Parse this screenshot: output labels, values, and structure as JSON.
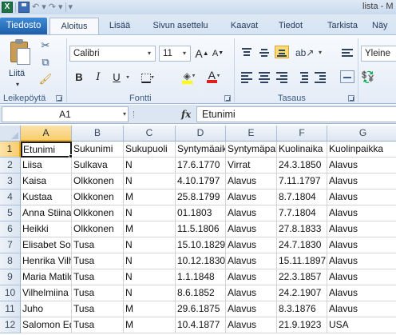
{
  "app": {
    "logo_letter": "X",
    "window_title": "lista - M",
    "quick_access": [
      "save-icon",
      "undo-icon",
      "redo-icon"
    ],
    "undo_glyph": "↶",
    "redo_glyph": "↷",
    "dropdown_glyph": "▾",
    "accent_color": "#1f5ea8"
  },
  "tabs": [
    "Tiedosto",
    "Aloitus",
    "Lisää",
    "Sivun asettelu",
    "Kaavat",
    "Tiedot",
    "Tarkista",
    "Näy"
  ],
  "active_tab": "Aloitus",
  "ribbon": {
    "clipboard": {
      "label": "Leikepöytä",
      "paste_label": "Liitä"
    },
    "font": {
      "label": "Fontti",
      "font_name": "Calibri",
      "font_size": "11",
      "bold": "B",
      "italic": "I",
      "underline": "U",
      "grow": "A",
      "shrink": "A"
    },
    "alignment": {
      "label": "Tasaus"
    },
    "number": {
      "format": "Yleine"
    }
  },
  "formula_bar": {
    "name_box": "A1",
    "fx": "fx",
    "formula": "Etunimi"
  },
  "sheet": {
    "columns": [
      "A",
      "B",
      "C",
      "D",
      "E",
      "F",
      "G"
    ],
    "selected_cell": "A1",
    "rows": [
      {
        "num": "1",
        "cells": [
          "Etunimi",
          "Sukunimi",
          "Sukupuoli",
          "Syntymäaika",
          "Syntymäpaikka",
          "Kuolinaika",
          "Kuolinpaikka"
        ]
      },
      {
        "num": "2",
        "cells": [
          "Liisa",
          "Sulkava",
          "N",
          "17.6.1770",
          "Virrat",
          "24.3.1850",
          "Alavus"
        ]
      },
      {
        "num": "3",
        "cells": [
          "Kaisa",
          "Olkkonen",
          "N",
          "4.10.1797",
          "Alavus",
          "7.11.1797",
          "Alavus"
        ]
      },
      {
        "num": "4",
        "cells": [
          "Kustaa",
          "Olkkonen",
          "M",
          "25.8.1799",
          "Alavus",
          "8.7.1804",
          "Alavus"
        ]
      },
      {
        "num": "5",
        "cells": [
          "Anna Stiina",
          "Olkkonen",
          "N",
          "01.1803",
          "Alavus",
          "7.7.1804",
          "Alavus"
        ]
      },
      {
        "num": "6",
        "cells": [
          "Heikki",
          "Olkkonen",
          "M",
          "11.5.1806",
          "Alavus",
          "27.8.1833",
          "Alavus"
        ]
      },
      {
        "num": "7",
        "cells": [
          "Elisabet Sofia",
          "Tusa",
          "N",
          "15.10.1829",
          "Alavus",
          "24.7.1830",
          "Alavus"
        ]
      },
      {
        "num": "8",
        "cells": [
          "Henrika Vilhelmiina",
          "Tusa",
          "N",
          "10.12.1830",
          "Alavus",
          "15.11.1897",
          "Alavus"
        ]
      },
      {
        "num": "9",
        "cells": [
          "Maria Matilda",
          "Tusa",
          "N",
          "1.1.1848",
          "Alavus",
          "22.3.1857",
          "Alavus"
        ]
      },
      {
        "num": "10",
        "cells": [
          "Vilhelmiina",
          "Tusa",
          "N",
          "8.6.1852",
          "Alavus",
          "24.2.1907",
          "Alavus"
        ]
      },
      {
        "num": "11",
        "cells": [
          "Juho",
          "Tusa",
          "M",
          "29.6.1875",
          "Alavus",
          "8.3.1876",
          "Alavus"
        ]
      },
      {
        "num": "12",
        "cells": [
          "Salomon Edvard",
          "Tusa",
          "M",
          "10.4.1877",
          "Alavus",
          "21.9.1923",
          "USA"
        ]
      }
    ]
  }
}
